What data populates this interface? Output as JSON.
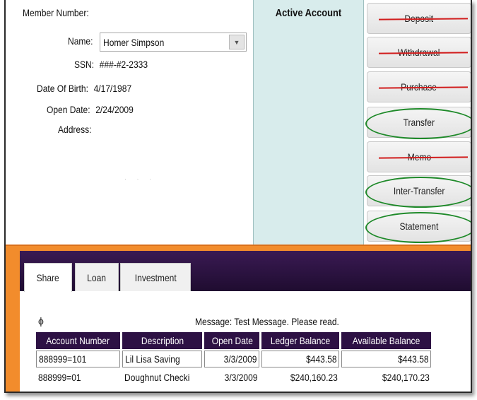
{
  "member": {
    "member_number_label": "Member Number:",
    "member_number_value": "",
    "name_label": "Name:",
    "name_value": "Homer Simpson",
    "ssn_label": "SSN:",
    "ssn_value": "###-#2-2333",
    "dob_label": "Date Of Birth:",
    "dob_value": "4/17/1987",
    "open_date_label": "Open Date:",
    "open_date_value": "2/24/2009",
    "address_label": "Address:",
    "address_value": "",
    "dropdown_icon": "chevron-down-icon"
  },
  "active_account": {
    "title": "Active Account",
    "background_color": "#d8ecec"
  },
  "actions": [
    {
      "label": "Deposit",
      "struck": true
    },
    {
      "label": "Withdrawal",
      "struck": true
    },
    {
      "label": "Purchase",
      "struck": true
    },
    {
      "label": "Transfer",
      "circled": true
    },
    {
      "label": "Memo",
      "struck": true
    },
    {
      "label": "Inter-Transfer",
      "circled": true
    },
    {
      "label": "Statement",
      "circled": true
    }
  ],
  "annotation_colors": {
    "strike": "#d11c1c",
    "circle": "#1f8a2a"
  },
  "tabs": [
    {
      "label": "Share",
      "selected": true
    },
    {
      "label": "Loan",
      "selected": false
    },
    {
      "label": "Investment",
      "selected": false
    }
  ],
  "colors": {
    "tab_bar": "#2d1144",
    "container_border": "#f28c2c",
    "table_header": "#2d1144"
  },
  "share": {
    "symbol": "ϕ",
    "message": "Message: Test Message. Please read.",
    "columns": [
      "Account Number",
      "Description",
      "Open Date",
      "Ledger Balance",
      "Available Balance"
    ],
    "rows": [
      [
        "888999=101",
        "Lil Lisa Saving",
        "3/3/2009",
        "$443.58",
        "$443.58"
      ],
      [
        "888999=01",
        "Doughnut Checki",
        "3/3/2009",
        "$240,160.23",
        "$240,170.23"
      ]
    ]
  }
}
